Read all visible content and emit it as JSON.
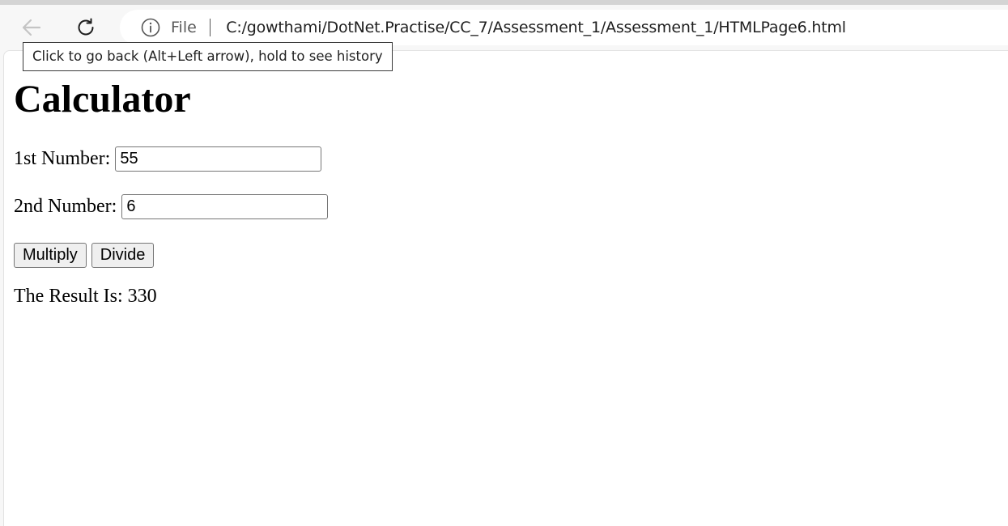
{
  "browser": {
    "back_tooltip": "Click to go back (Alt+Left arrow), hold to see history",
    "scheme_label": "File",
    "url": "C:/gowthami/DotNet.Practise/CC_7/Assessment_1/Assessment_1/HTMLPage6.html",
    "icons": {
      "back": "arrow-left-icon",
      "reload": "reload-icon",
      "info": "info-icon"
    }
  },
  "page": {
    "title": "Calculator",
    "fields": [
      {
        "label": "1st Number:",
        "value": "55"
      },
      {
        "label": "2nd Number:",
        "value": "6"
      }
    ],
    "buttons": {
      "multiply": "Multiply",
      "divide": "Divide"
    },
    "result_label": "The Result Is:",
    "result_value": "330"
  }
}
